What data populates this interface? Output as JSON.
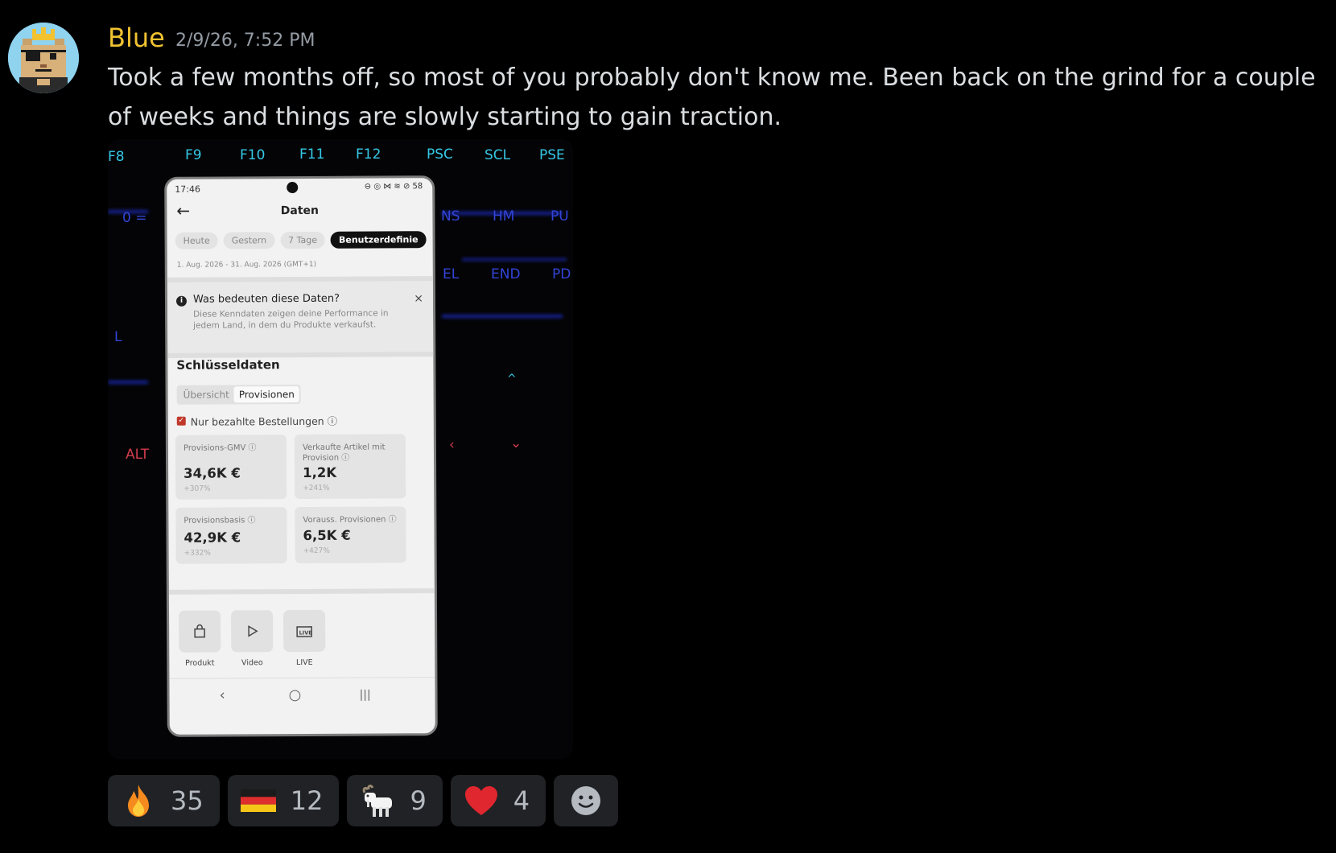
{
  "message": {
    "author": "Blue",
    "timestamp": "2/9/26, 7:52 PM",
    "text": "Took a few months off, so most of you probably don't know me. Been back on the grind for a couple of weeks and things are slowly starting to gain traction."
  },
  "attachment": {
    "keys": {
      "f8": "F8",
      "f9": "F9",
      "f10": "F10",
      "f11": "F11",
      "f12": "F12",
      "psc": "PSC",
      "scl": "SCL",
      "pse": "PSE",
      "ins": "NS",
      "hm": "HM",
      "pu": "PU",
      "del": "EL",
      "end": "END",
      "pd": "PD",
      "zero": "0 =",
      "alt": "ALT",
      "l": "L"
    },
    "phone": {
      "status_time": "17:46",
      "status_icons": "⊖ ◎ ⋈ ≋ ⊘ 58",
      "back": "←",
      "title": "Daten",
      "chips": [
        "Heute",
        "Gestern",
        "7 Tage",
        "Benutzerdefinie"
      ],
      "date_range": "1. Aug. 2026 - 31. Aug. 2026 (GMT+1)",
      "info": {
        "icon": "i",
        "title": "Was bedeuten diese Daten?",
        "close": "×",
        "desc": "Diese Kenndaten zeigen deine Performance in jedem Land, in dem du Produkte verkaufst."
      },
      "section_title": "Schlüsseldaten",
      "tabs": [
        "Übersicht",
        "Provisionen"
      ],
      "checkbox_label": "Nur bezahlte Bestellungen ⓘ",
      "cards": [
        {
          "label": "Provisions-GMV ⓘ",
          "value": "34,6K €",
          "change": "+307%"
        },
        {
          "label": "Verkaufte Artikel mit Provision ⓘ",
          "value": "1,2K",
          "change": "+241%"
        },
        {
          "label": "Provisionsbasis ⓘ",
          "value": "42,9K €",
          "change": "+332%"
        },
        {
          "label": "Vorauss. Provisionen ⓘ",
          "value": "6,5K €",
          "change": "+427%"
        }
      ],
      "nav": [
        {
          "label": "Produkt",
          "icon": "bag-icon"
        },
        {
          "label": "Video",
          "icon": "play-icon"
        },
        {
          "label": "LIVE",
          "icon": "live-icon"
        }
      ],
      "sys": {
        "back": "‹",
        "home": "○",
        "recents": "|||"
      }
    }
  },
  "reactions": [
    {
      "emoji": "fire",
      "count": "35"
    },
    {
      "emoji": "germany-flag",
      "count": "12"
    },
    {
      "emoji": "goat",
      "count": "9"
    },
    {
      "emoji": "red-heart",
      "count": "4"
    }
  ]
}
